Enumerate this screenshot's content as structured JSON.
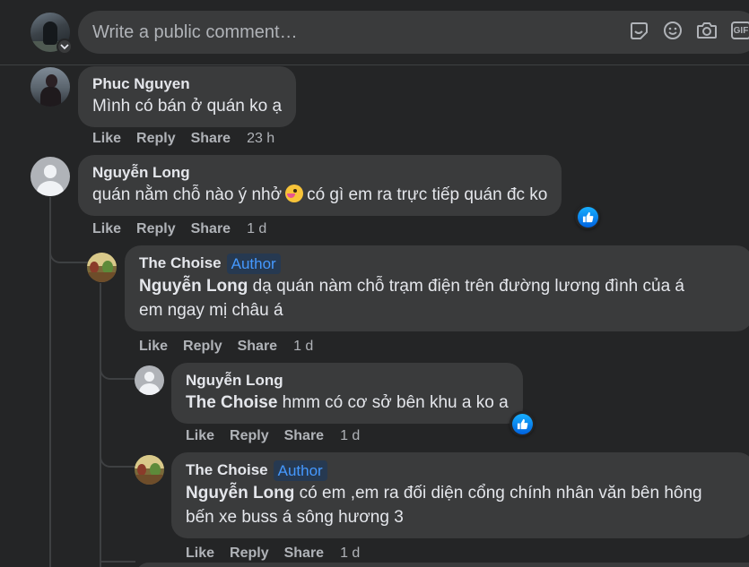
{
  "composer": {
    "placeholder": "Write a public comment…",
    "icons": [
      "sticker-icon",
      "emoji-icon",
      "camera-icon",
      "gif-icon"
    ],
    "gif_label": "GIF"
  },
  "comments": [
    {
      "author": "Phuc Nguyen",
      "text": "Mình có bán ở quán ko ạ",
      "actions": {
        "like": "Like",
        "reply": "Reply",
        "share": "Share"
      },
      "time": "23 h"
    },
    {
      "author": "Nguyễn Long",
      "text_before_emoji": "quán nằm chỗ nào ý nhở",
      "text_after_emoji": "có gì em ra trực tiếp quán đc ko",
      "emoji": "face-with-tongue-emoji",
      "actions": {
        "like": "Like",
        "reply": "Reply",
        "share": "Share"
      },
      "time": "1 d",
      "reaction": "like"
    }
  ],
  "replies": [
    {
      "author": "The Choise",
      "badge": "Author",
      "mention": "Nguyễn Long",
      "text_line1": " dạ quán nàm chỗ trạm điện trên đường lương đình của á",
      "text_line2": "em ngay mị châu á",
      "actions": {
        "like": "Like",
        "reply": "Reply",
        "share": "Share"
      },
      "time": "1 d"
    },
    {
      "author": "Nguyễn Long",
      "mention": "The Choise",
      "text": " hmm có cơ sở bên khu a ko a",
      "actions": {
        "like": "Like",
        "reply": "Reply",
        "share": "Share"
      },
      "time": "1 d",
      "reaction": "like"
    },
    {
      "author": "The Choise",
      "badge": "Author",
      "mention": "Nguyễn Long",
      "text_line1": " có em ,em ra đối diện cổng chính nhân văn bên hông",
      "text_line2": "bến xe buss á sông hương 3",
      "actions": {
        "like": "Like",
        "reply": "Reply",
        "share": "Share"
      },
      "time": "1 d"
    }
  ],
  "colors": {
    "background": "#242526",
    "bubble": "#3a3b3c",
    "primary_text": "#e4e6eb",
    "secondary_text": "#b0b3b8",
    "author_badge_text": "#4599ff",
    "author_badge_bg": "#263951",
    "like_blue": "#1877f2"
  }
}
